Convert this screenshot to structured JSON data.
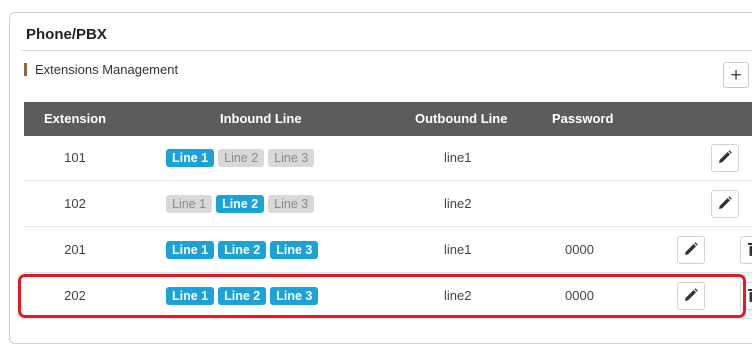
{
  "page": {
    "title": "Phone/PBX"
  },
  "section": {
    "title": "Extensions Management",
    "add_icon": "plus-icon"
  },
  "table": {
    "headers": [
      "Extension",
      "Inbound Line",
      "Outbound Line",
      "Password"
    ],
    "rows": [
      {
        "extension": "101",
        "inbound": [
          {
            "label": "Line 1",
            "active": true
          },
          {
            "label": "Line 2",
            "active": false
          },
          {
            "label": "Line 3",
            "active": false
          }
        ],
        "outbound": "line1",
        "password": "",
        "actions": [
          "edit"
        ]
      },
      {
        "extension": "102",
        "inbound": [
          {
            "label": "Line 1",
            "active": false
          },
          {
            "label": "Line 2",
            "active": true
          },
          {
            "label": "Line 3",
            "active": false
          }
        ],
        "outbound": "line2",
        "password": "",
        "actions": [
          "edit"
        ]
      },
      {
        "extension": "201",
        "inbound": [
          {
            "label": "Line 1",
            "active": true
          },
          {
            "label": "Line 2",
            "active": true
          },
          {
            "label": "Line 3",
            "active": true
          }
        ],
        "outbound": "line1",
        "password": "0000",
        "actions": [
          "edit",
          "delete"
        ]
      },
      {
        "extension": "202",
        "inbound": [
          {
            "label": "Line 1",
            "active": true
          },
          {
            "label": "Line 2",
            "active": true
          },
          {
            "label": "Line 3",
            "active": true
          }
        ],
        "outbound": "line2",
        "password": "0000",
        "actions": [
          "edit",
          "delete"
        ]
      }
    ]
  },
  "colors": {
    "active_line": "#1aa3d9",
    "inactive_line": "#d8d8d8",
    "header_bg": "#5c5c5c",
    "highlight": "#e8161e",
    "section_bar": "#8a6a3c"
  }
}
